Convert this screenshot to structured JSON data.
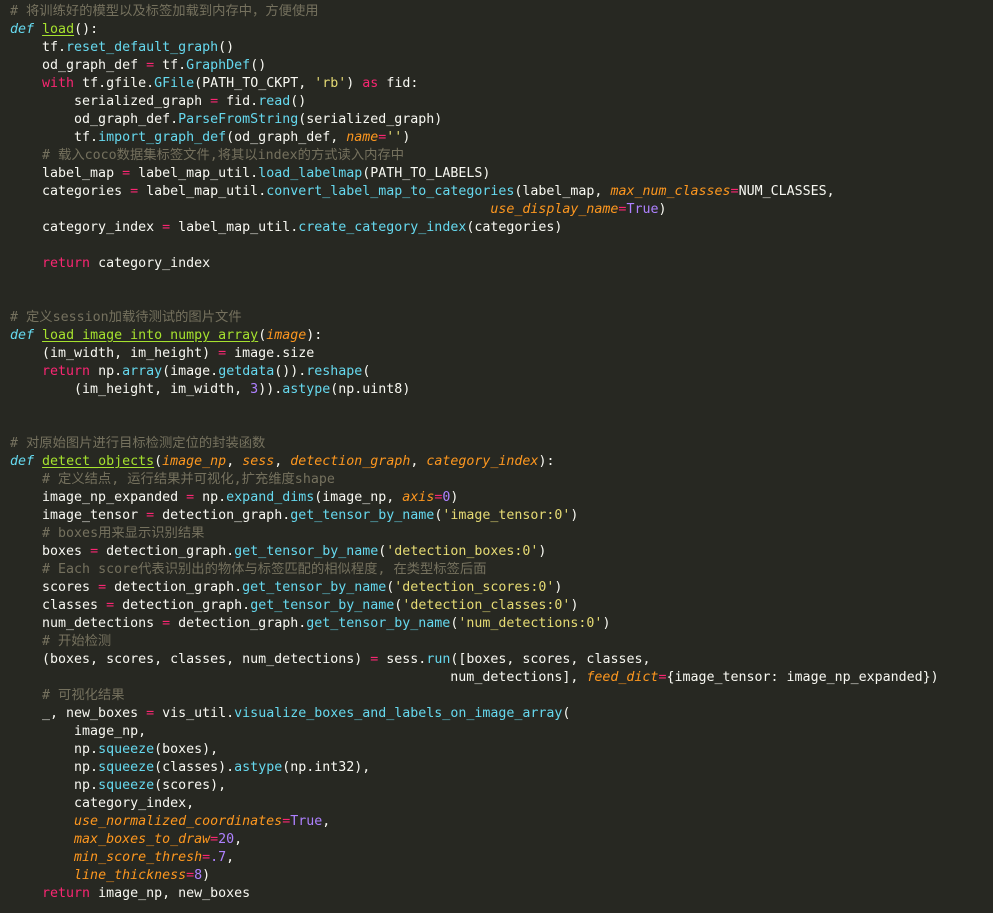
{
  "editor": {
    "language": "python",
    "theme_colors": {
      "background": "#272822",
      "text": "#f8f8f2",
      "comment": "#75715e",
      "keyword": "#f92672",
      "def_keyword": "#66d9ef",
      "function_name": "#a6e22e",
      "method": "#66d9ef",
      "parameter": "#fd971f",
      "string": "#e6db74",
      "number": "#ae81ff"
    }
  },
  "lines": [
    [
      {
        "c": "cm",
        "t": "# 将训练好的模型以及标签加载到内存中，方便使用"
      }
    ],
    [
      {
        "c": "df",
        "t": "def"
      },
      {
        "c": "tx",
        "t": " "
      },
      {
        "c": "fn",
        "t": "load"
      },
      {
        "c": "tx",
        "t": "():"
      }
    ],
    [
      {
        "c": "tx",
        "t": "    tf."
      },
      {
        "c": "mt",
        "t": "reset_default_graph"
      },
      {
        "c": "tx",
        "t": "()"
      }
    ],
    [
      {
        "c": "tx",
        "t": "    od_graph_def "
      },
      {
        "c": "kw",
        "t": "="
      },
      {
        "c": "tx",
        "t": " tf."
      },
      {
        "c": "mt",
        "t": "GraphDef"
      },
      {
        "c": "tx",
        "t": "()"
      }
    ],
    [
      {
        "c": "tx",
        "t": "    "
      },
      {
        "c": "kw",
        "t": "with"
      },
      {
        "c": "tx",
        "t": " tf.gfile."
      },
      {
        "c": "mt",
        "t": "GFile"
      },
      {
        "c": "tx",
        "t": "(PATH_TO_CKPT, "
      },
      {
        "c": "st",
        "t": "'rb'"
      },
      {
        "c": "tx",
        "t": ") "
      },
      {
        "c": "kw",
        "t": "as"
      },
      {
        "c": "tx",
        "t": " fid:"
      }
    ],
    [
      {
        "c": "tx",
        "t": "        serialized_graph "
      },
      {
        "c": "kw",
        "t": "="
      },
      {
        "c": "tx",
        "t": " fid."
      },
      {
        "c": "mt",
        "t": "read"
      },
      {
        "c": "tx",
        "t": "()"
      }
    ],
    [
      {
        "c": "tx",
        "t": "        od_graph_def."
      },
      {
        "c": "mt",
        "t": "ParseFromString"
      },
      {
        "c": "tx",
        "t": "(serialized_graph)"
      }
    ],
    [
      {
        "c": "tx",
        "t": "        tf."
      },
      {
        "c": "mt",
        "t": "import_graph_def"
      },
      {
        "c": "tx",
        "t": "(od_graph_def, "
      },
      {
        "c": "pa",
        "t": "name"
      },
      {
        "c": "kw",
        "t": "="
      },
      {
        "c": "st",
        "t": "''"
      },
      {
        "c": "tx",
        "t": ")"
      }
    ],
    [
      {
        "c": "tx",
        "t": "    "
      },
      {
        "c": "cm",
        "t": "# 载入coco数据集标签文件,将其以index的方式读入内存中"
      }
    ],
    [
      {
        "c": "tx",
        "t": "    label_map "
      },
      {
        "c": "kw",
        "t": "="
      },
      {
        "c": "tx",
        "t": " label_map_util."
      },
      {
        "c": "mt",
        "t": "load_labelmap"
      },
      {
        "c": "tx",
        "t": "(PATH_TO_LABELS)"
      }
    ],
    [
      {
        "c": "tx",
        "t": "    categories "
      },
      {
        "c": "kw",
        "t": "="
      },
      {
        "c": "tx",
        "t": " label_map_util."
      },
      {
        "c": "mt",
        "t": "convert_label_map_to_categories"
      },
      {
        "c": "tx",
        "t": "(label_map, "
      },
      {
        "c": "pa",
        "t": "max_num_classes"
      },
      {
        "c": "kw",
        "t": "="
      },
      {
        "c": "tx",
        "t": "NUM_CLASSES,"
      }
    ],
    [
      {
        "c": "tx",
        "t": "                                                            "
      },
      {
        "c": "pa",
        "t": "use_display_name"
      },
      {
        "c": "kw",
        "t": "="
      },
      {
        "c": "nm",
        "t": "True"
      },
      {
        "c": "tx",
        "t": ")"
      }
    ],
    [
      {
        "c": "tx",
        "t": "    category_index "
      },
      {
        "c": "kw",
        "t": "="
      },
      {
        "c": "tx",
        "t": " label_map_util."
      },
      {
        "c": "mt",
        "t": "create_category_index"
      },
      {
        "c": "tx",
        "t": "(categories)"
      }
    ],
    [
      {
        "c": "tx",
        "t": ""
      }
    ],
    [
      {
        "c": "tx",
        "t": "    "
      },
      {
        "c": "kw",
        "t": "return"
      },
      {
        "c": "tx",
        "t": " category_index"
      }
    ],
    [
      {
        "c": "tx",
        "t": ""
      }
    ],
    [
      {
        "c": "tx",
        "t": ""
      }
    ],
    [
      {
        "c": "cm",
        "t": "# 定义session加载待测试的图片文件"
      }
    ],
    [
      {
        "c": "df",
        "t": "def"
      },
      {
        "c": "tx",
        "t": " "
      },
      {
        "c": "fn",
        "t": "load_image_into_numpy_array"
      },
      {
        "c": "tx",
        "t": "("
      },
      {
        "c": "pa",
        "t": "image"
      },
      {
        "c": "tx",
        "t": "):"
      }
    ],
    [
      {
        "c": "tx",
        "t": "    (im_width, im_height) "
      },
      {
        "c": "kw",
        "t": "="
      },
      {
        "c": "tx",
        "t": " image.size"
      }
    ],
    [
      {
        "c": "tx",
        "t": "    "
      },
      {
        "c": "kw",
        "t": "return"
      },
      {
        "c": "tx",
        "t": " np."
      },
      {
        "c": "mt",
        "t": "array"
      },
      {
        "c": "tx",
        "t": "(image."
      },
      {
        "c": "mt",
        "t": "getdata"
      },
      {
        "c": "tx",
        "t": "())."
      },
      {
        "c": "mt",
        "t": "reshape"
      },
      {
        "c": "tx",
        "t": "("
      }
    ],
    [
      {
        "c": "tx",
        "t": "        (im_height, im_width, "
      },
      {
        "c": "nm",
        "t": "3"
      },
      {
        "c": "tx",
        "t": "))."
      },
      {
        "c": "mt",
        "t": "astype"
      },
      {
        "c": "tx",
        "t": "(np.uint8)"
      }
    ],
    [
      {
        "c": "tx",
        "t": ""
      }
    ],
    [
      {
        "c": "tx",
        "t": ""
      }
    ],
    [
      {
        "c": "cm",
        "t": "# 对原始图片进行目标检测定位的封装函数"
      }
    ],
    [
      {
        "c": "df",
        "t": "def"
      },
      {
        "c": "tx",
        "t": " "
      },
      {
        "c": "fn",
        "t": "detect_objects"
      },
      {
        "c": "tx",
        "t": "("
      },
      {
        "c": "pa",
        "t": "image_np"
      },
      {
        "c": "tx",
        "t": ", "
      },
      {
        "c": "pa",
        "t": "sess"
      },
      {
        "c": "tx",
        "t": ", "
      },
      {
        "c": "pa",
        "t": "detection_graph"
      },
      {
        "c": "tx",
        "t": ", "
      },
      {
        "c": "pa",
        "t": "category_index"
      },
      {
        "c": "tx",
        "t": "):"
      }
    ],
    [
      {
        "c": "tx",
        "t": "    "
      },
      {
        "c": "cm",
        "t": "# 定义结点, 运行结果并可视化,扩充维度shape"
      }
    ],
    [
      {
        "c": "tx",
        "t": "    image_np_expanded "
      },
      {
        "c": "kw",
        "t": "="
      },
      {
        "c": "tx",
        "t": " np."
      },
      {
        "c": "mt",
        "t": "expand_dims"
      },
      {
        "c": "tx",
        "t": "(image_np, "
      },
      {
        "c": "pa",
        "t": "axis"
      },
      {
        "c": "kw",
        "t": "="
      },
      {
        "c": "nm",
        "t": "0"
      },
      {
        "c": "tx",
        "t": ")"
      }
    ],
    [
      {
        "c": "tx",
        "t": "    image_tensor "
      },
      {
        "c": "kw",
        "t": "="
      },
      {
        "c": "tx",
        "t": " detection_graph."
      },
      {
        "c": "mt",
        "t": "get_tensor_by_name"
      },
      {
        "c": "tx",
        "t": "("
      },
      {
        "c": "st",
        "t": "'image_tensor:0'"
      },
      {
        "c": "tx",
        "t": ")"
      }
    ],
    [
      {
        "c": "tx",
        "t": "    "
      },
      {
        "c": "cm",
        "t": "# boxes用来显示识别结果"
      }
    ],
    [
      {
        "c": "tx",
        "t": "    boxes "
      },
      {
        "c": "kw",
        "t": "="
      },
      {
        "c": "tx",
        "t": " detection_graph."
      },
      {
        "c": "mt",
        "t": "get_tensor_by_name"
      },
      {
        "c": "tx",
        "t": "("
      },
      {
        "c": "st",
        "t": "'detection_boxes:0'"
      },
      {
        "c": "tx",
        "t": ")"
      }
    ],
    [
      {
        "c": "tx",
        "t": "    "
      },
      {
        "c": "cm",
        "t": "# Each score代表识别出的物体与标签匹配的相似程度, 在类型标签后面"
      }
    ],
    [
      {
        "c": "tx",
        "t": "    scores "
      },
      {
        "c": "kw",
        "t": "="
      },
      {
        "c": "tx",
        "t": " detection_graph."
      },
      {
        "c": "mt",
        "t": "get_tensor_by_name"
      },
      {
        "c": "tx",
        "t": "("
      },
      {
        "c": "st",
        "t": "'detection_scores:0'"
      },
      {
        "c": "tx",
        "t": ")"
      }
    ],
    [
      {
        "c": "tx",
        "t": "    classes "
      },
      {
        "c": "kw",
        "t": "="
      },
      {
        "c": "tx",
        "t": " detection_graph."
      },
      {
        "c": "mt",
        "t": "get_tensor_by_name"
      },
      {
        "c": "tx",
        "t": "("
      },
      {
        "c": "st",
        "t": "'detection_classes:0'"
      },
      {
        "c": "tx",
        "t": ")"
      }
    ],
    [
      {
        "c": "tx",
        "t": "    num_detections "
      },
      {
        "c": "kw",
        "t": "="
      },
      {
        "c": "tx",
        "t": " detection_graph."
      },
      {
        "c": "mt",
        "t": "get_tensor_by_name"
      },
      {
        "c": "tx",
        "t": "("
      },
      {
        "c": "st",
        "t": "'num_detections:0'"
      },
      {
        "c": "tx",
        "t": ")"
      }
    ],
    [
      {
        "c": "tx",
        "t": "    "
      },
      {
        "c": "cm",
        "t": "# 开始检测"
      }
    ],
    [
      {
        "c": "tx",
        "t": "    (boxes, scores, classes, num_detections) "
      },
      {
        "c": "kw",
        "t": "="
      },
      {
        "c": "tx",
        "t": " sess."
      },
      {
        "c": "mt",
        "t": "run"
      },
      {
        "c": "tx",
        "t": "([boxes, scores, classes,"
      }
    ],
    [
      {
        "c": "tx",
        "t": "                                                       num_detections], "
      },
      {
        "c": "pa",
        "t": "feed_dict"
      },
      {
        "c": "kw",
        "t": "="
      },
      {
        "c": "tx",
        "t": "{image_tensor: image_np_expanded})"
      }
    ],
    [
      {
        "c": "tx",
        "t": "    "
      },
      {
        "c": "cm",
        "t": "# 可视化结果"
      }
    ],
    [
      {
        "c": "tx",
        "t": "    _, new_boxes "
      },
      {
        "c": "kw",
        "t": "="
      },
      {
        "c": "tx",
        "t": " vis_util."
      },
      {
        "c": "mt",
        "t": "visualize_boxes_and_labels_on_image_array"
      },
      {
        "c": "tx",
        "t": "("
      }
    ],
    [
      {
        "c": "tx",
        "t": "        image_np,"
      }
    ],
    [
      {
        "c": "tx",
        "t": "        np."
      },
      {
        "c": "mt",
        "t": "squeeze"
      },
      {
        "c": "tx",
        "t": "(boxes),"
      }
    ],
    [
      {
        "c": "tx",
        "t": "        np."
      },
      {
        "c": "mt",
        "t": "squeeze"
      },
      {
        "c": "tx",
        "t": "(classes)."
      },
      {
        "c": "mt",
        "t": "astype"
      },
      {
        "c": "tx",
        "t": "(np.int32),"
      }
    ],
    [
      {
        "c": "tx",
        "t": "        np."
      },
      {
        "c": "mt",
        "t": "squeeze"
      },
      {
        "c": "tx",
        "t": "(scores),"
      }
    ],
    [
      {
        "c": "tx",
        "t": "        category_index,"
      }
    ],
    [
      {
        "c": "tx",
        "t": "        "
      },
      {
        "c": "pa",
        "t": "use_normalized_coordinates"
      },
      {
        "c": "kw",
        "t": "="
      },
      {
        "c": "nm",
        "t": "True"
      },
      {
        "c": "tx",
        "t": ","
      }
    ],
    [
      {
        "c": "tx",
        "t": "        "
      },
      {
        "c": "pa",
        "t": "max_boxes_to_draw"
      },
      {
        "c": "kw",
        "t": "="
      },
      {
        "c": "nm",
        "t": "20"
      },
      {
        "c": "tx",
        "t": ","
      }
    ],
    [
      {
        "c": "tx",
        "t": "        "
      },
      {
        "c": "pa",
        "t": "min_score_thresh"
      },
      {
        "c": "kw",
        "t": "="
      },
      {
        "c": "nm",
        "t": ".7"
      },
      {
        "c": "tx",
        "t": ","
      }
    ],
    [
      {
        "c": "tx",
        "t": "        "
      },
      {
        "c": "pa",
        "t": "line_thickness"
      },
      {
        "c": "kw",
        "t": "="
      },
      {
        "c": "nm",
        "t": "8"
      },
      {
        "c": "tx",
        "t": ")"
      }
    ],
    [
      {
        "c": "tx",
        "t": "    "
      },
      {
        "c": "kw",
        "t": "return"
      },
      {
        "c": "tx",
        "t": " image_np, new_boxes"
      }
    ]
  ]
}
